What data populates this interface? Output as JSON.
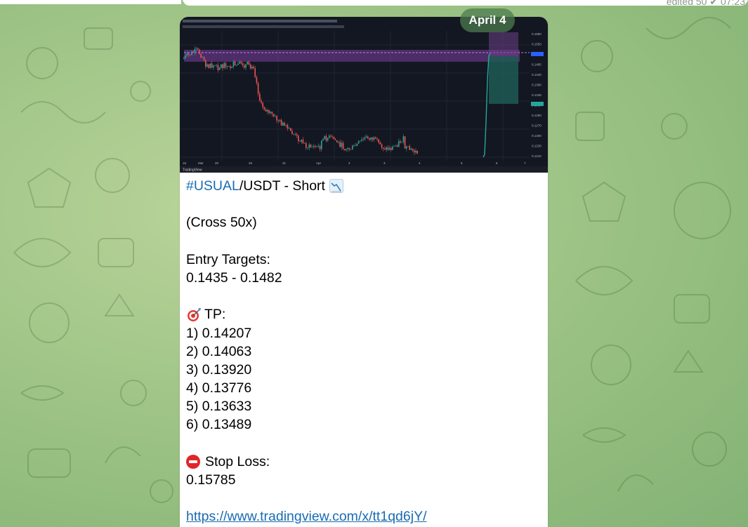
{
  "header": {
    "prev_meta": "edited  50 ✔ 07:23"
  },
  "date_pill": "April 4",
  "chart": {
    "icon": "tradingview-chart-image",
    "watermark": "TradingView",
    "price_labels": [
      "0.1580",
      "0.1550",
      "0.1490",
      "0.1485",
      "0.1440",
      "0.1390",
      "0.1346",
      "0.1330",
      "0.1290",
      "0.1270",
      "0.1250",
      "0.1230",
      "0.1210"
    ],
    "colors": {
      "background": "#131722",
      "up": "#26a69a",
      "down": "#ef5350",
      "zone": "#7b3fa0",
      "target_zone": "#1f5a55"
    }
  },
  "message": {
    "hashtag": "#USUAL",
    "pair_rest": "/USDT - Short",
    "chart_down_icon": "chart-decreasing-icon",
    "leverage": "(Cross 50x)",
    "entry_title": "Entry Targets:",
    "entry_range": "0.1435 - 0.1482",
    "tp_title": "TP:",
    "tp": [
      "1) 0.14207",
      "2) 0.14063",
      "3) 0.13920",
      "4) 0.13776",
      "5) 0.13633",
      "6) 0.13489"
    ],
    "sl_title": "Stop Loss:",
    "sl_value": "0.15785",
    "link": "https://www.tradingview.com/x/tt1qd6jY/"
  }
}
